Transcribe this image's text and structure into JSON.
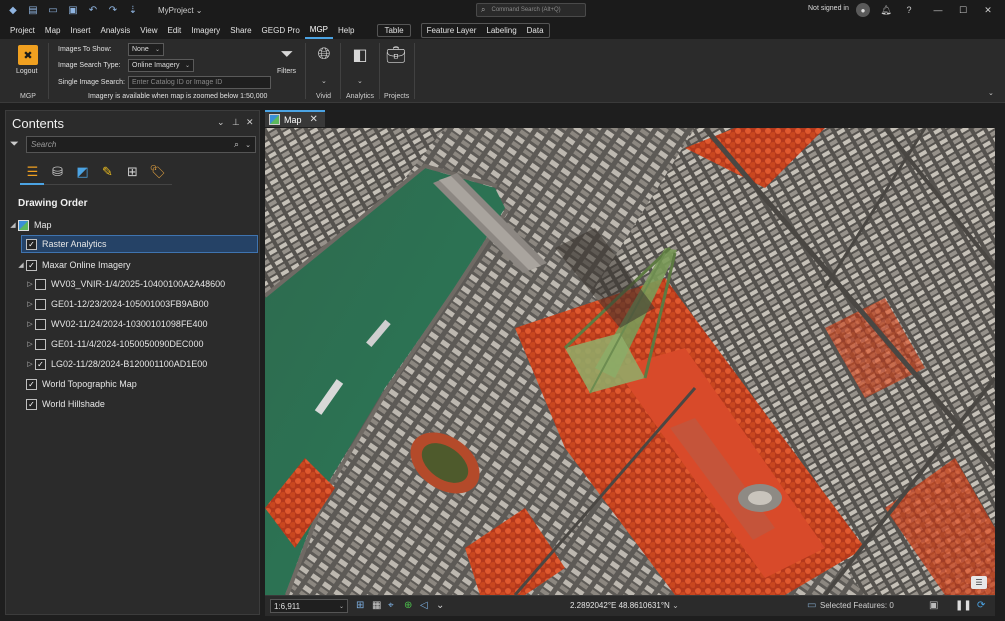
{
  "titlebar": {
    "project_name": "MyProject",
    "command_search_placeholder": "Command Search (Alt+Q)",
    "signed_in_status": "Not signed in",
    "quick_access_icons": [
      "new-project-icon",
      "open-project-icon",
      "save-project-icon",
      "undo-icon",
      "redo-icon",
      "customize-toolbar-icon"
    ]
  },
  "menubar": {
    "tabs": [
      "Project",
      "Map",
      "Insert",
      "Analysis",
      "View",
      "Edit",
      "Imagery",
      "Share",
      "GEGD Pro",
      "MGP",
      "Help"
    ],
    "active_tab": "MGP",
    "context_tab": "Table",
    "context_group_tabs": [
      "Feature Layer",
      "Labeling",
      "Data"
    ]
  },
  "ribbon": {
    "logout_label": "Logout",
    "mgp_group_label": "MGP",
    "images_to_show_label": "Images To Show:",
    "images_to_show_value": "None",
    "image_search_type_label": "Image Search Type:",
    "image_search_type_value": "Online Imagery",
    "single_image_search_label": "Single Image Search:",
    "single_image_search_placeholder": "Enter Catalog ID or Image ID",
    "zoom_note": "Imagery is available when map is zoomed below 1:50,000",
    "filters_label": "Filters",
    "vivid_group_label": "Vivid",
    "analytics_group_label": "Analytics",
    "projects_group_label": "Projects"
  },
  "contents": {
    "title": "Contents",
    "search_placeholder": "Search",
    "drawing_order_heading": "Drawing Order",
    "tool_icons": [
      "list-by-drawing-order-icon",
      "list-by-data-source-icon",
      "list-by-selection-icon",
      "list-by-editing-icon",
      "list-by-snapping-icon",
      "list-by-labeling-icon"
    ],
    "tree": {
      "map": "Map",
      "raster_analytics": "Raster Analytics",
      "maxar_online_imagery": "Maxar Online Imagery",
      "image_1": "WV03_VNIR-1/4/2025-10400100A2A48600",
      "image_2": "GE01-12/23/2024-105001003FB9AB00",
      "image_3": "WV02-11/24/2024-10300101098FE400",
      "image_4": "GE01-11/4/2024-1050050090DEC000",
      "image_5": "LG02-11/28/2024-B120001100AD1E00",
      "world_topographic_map": "World Topographic Map",
      "world_hillshade": "World Hillshade"
    }
  },
  "map_view": {
    "tab_label": "Map"
  },
  "statusbar": {
    "scale": "1:6,911",
    "coordinates": "2.2892042°E 48.8610631°N",
    "selected_features": "Selected Features: 0"
  },
  "colors": {
    "accent": "#4ba3e3",
    "mgp_logout": "#f0a020",
    "selection": "#254266"
  }
}
